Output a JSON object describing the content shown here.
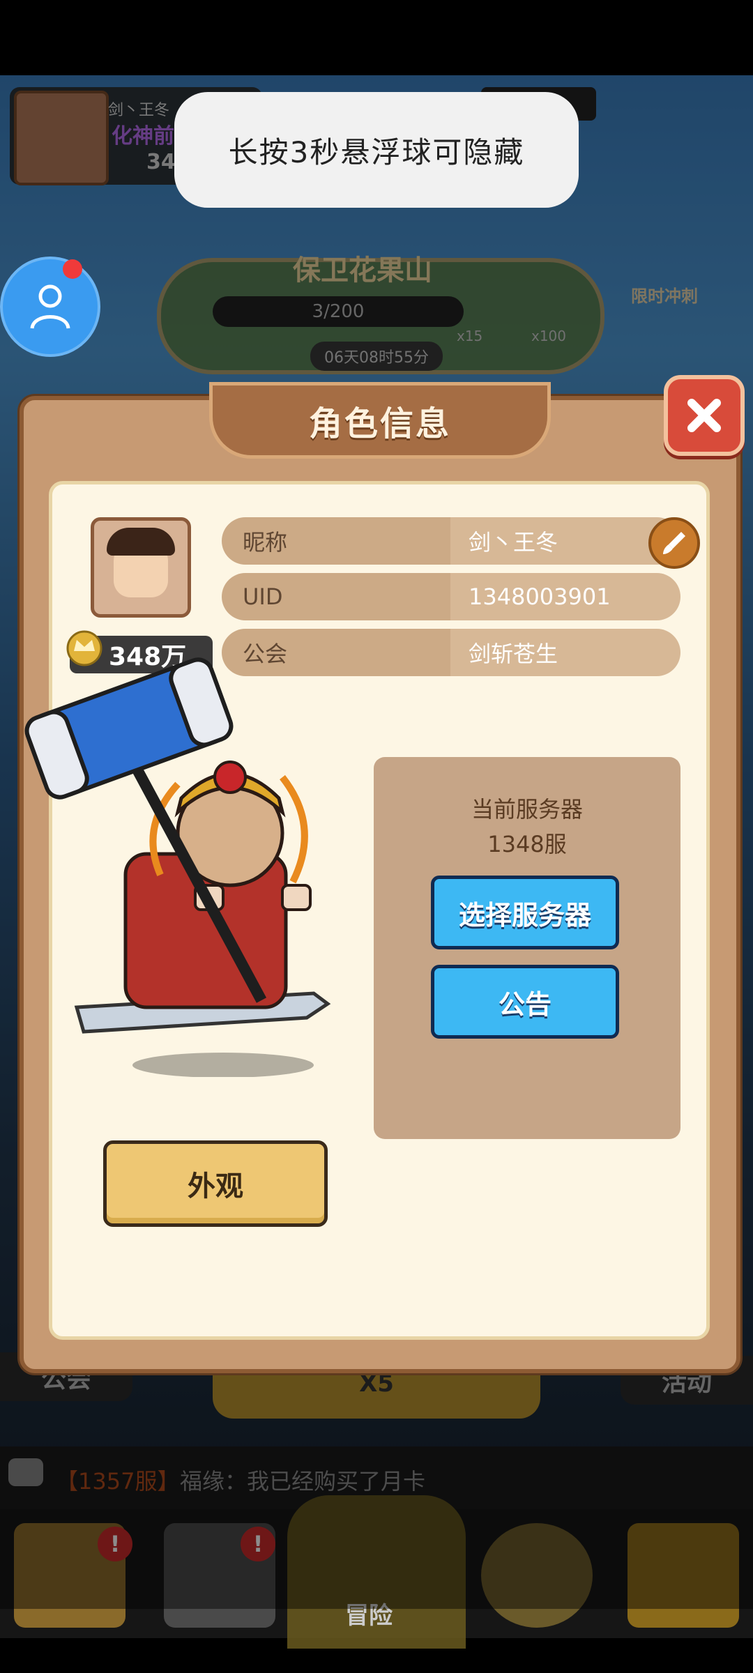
{
  "toast": {
    "text": "长按3秒悬浮球可隐藏"
  },
  "top_player": {
    "name": "剑丶王冬",
    "rank": "化神前",
    "power": "34"
  },
  "event": {
    "title": "保卫花果山",
    "progress": "3/200",
    "timer": "06天08时55分",
    "reward_a": "x15",
    "reward_b": "x100",
    "side_label": "限时冲刺"
  },
  "dialog": {
    "title": "角色信息",
    "close_icon": "close-icon",
    "power": "348万",
    "rows": [
      {
        "label": "昵称",
        "value": "剑丶王冬"
      },
      {
        "label": "UID",
        "value": "1348003901"
      },
      {
        "label": "公会",
        "value": "剑斩苍生"
      }
    ],
    "server": {
      "label": "当前服务器",
      "value": "1348服",
      "select_button": "选择服务器",
      "notice_button": "公告"
    },
    "outfit_button": "外观"
  },
  "background_buttons": {
    "guild": "公会",
    "boost": "X5",
    "activity": "活动"
  },
  "chat": {
    "server": "【1357服】",
    "message": "福缘：我已经购买了月卡"
  },
  "nav": {
    "center_label": "冒险",
    "badge": "!"
  },
  "colors": {
    "dialog_bg": "#c79a73",
    "panel_bg": "#fdf6e4",
    "blue_button": "#3db8f3",
    "gold_button": "#eec773",
    "close_red": "#d84b3a"
  }
}
